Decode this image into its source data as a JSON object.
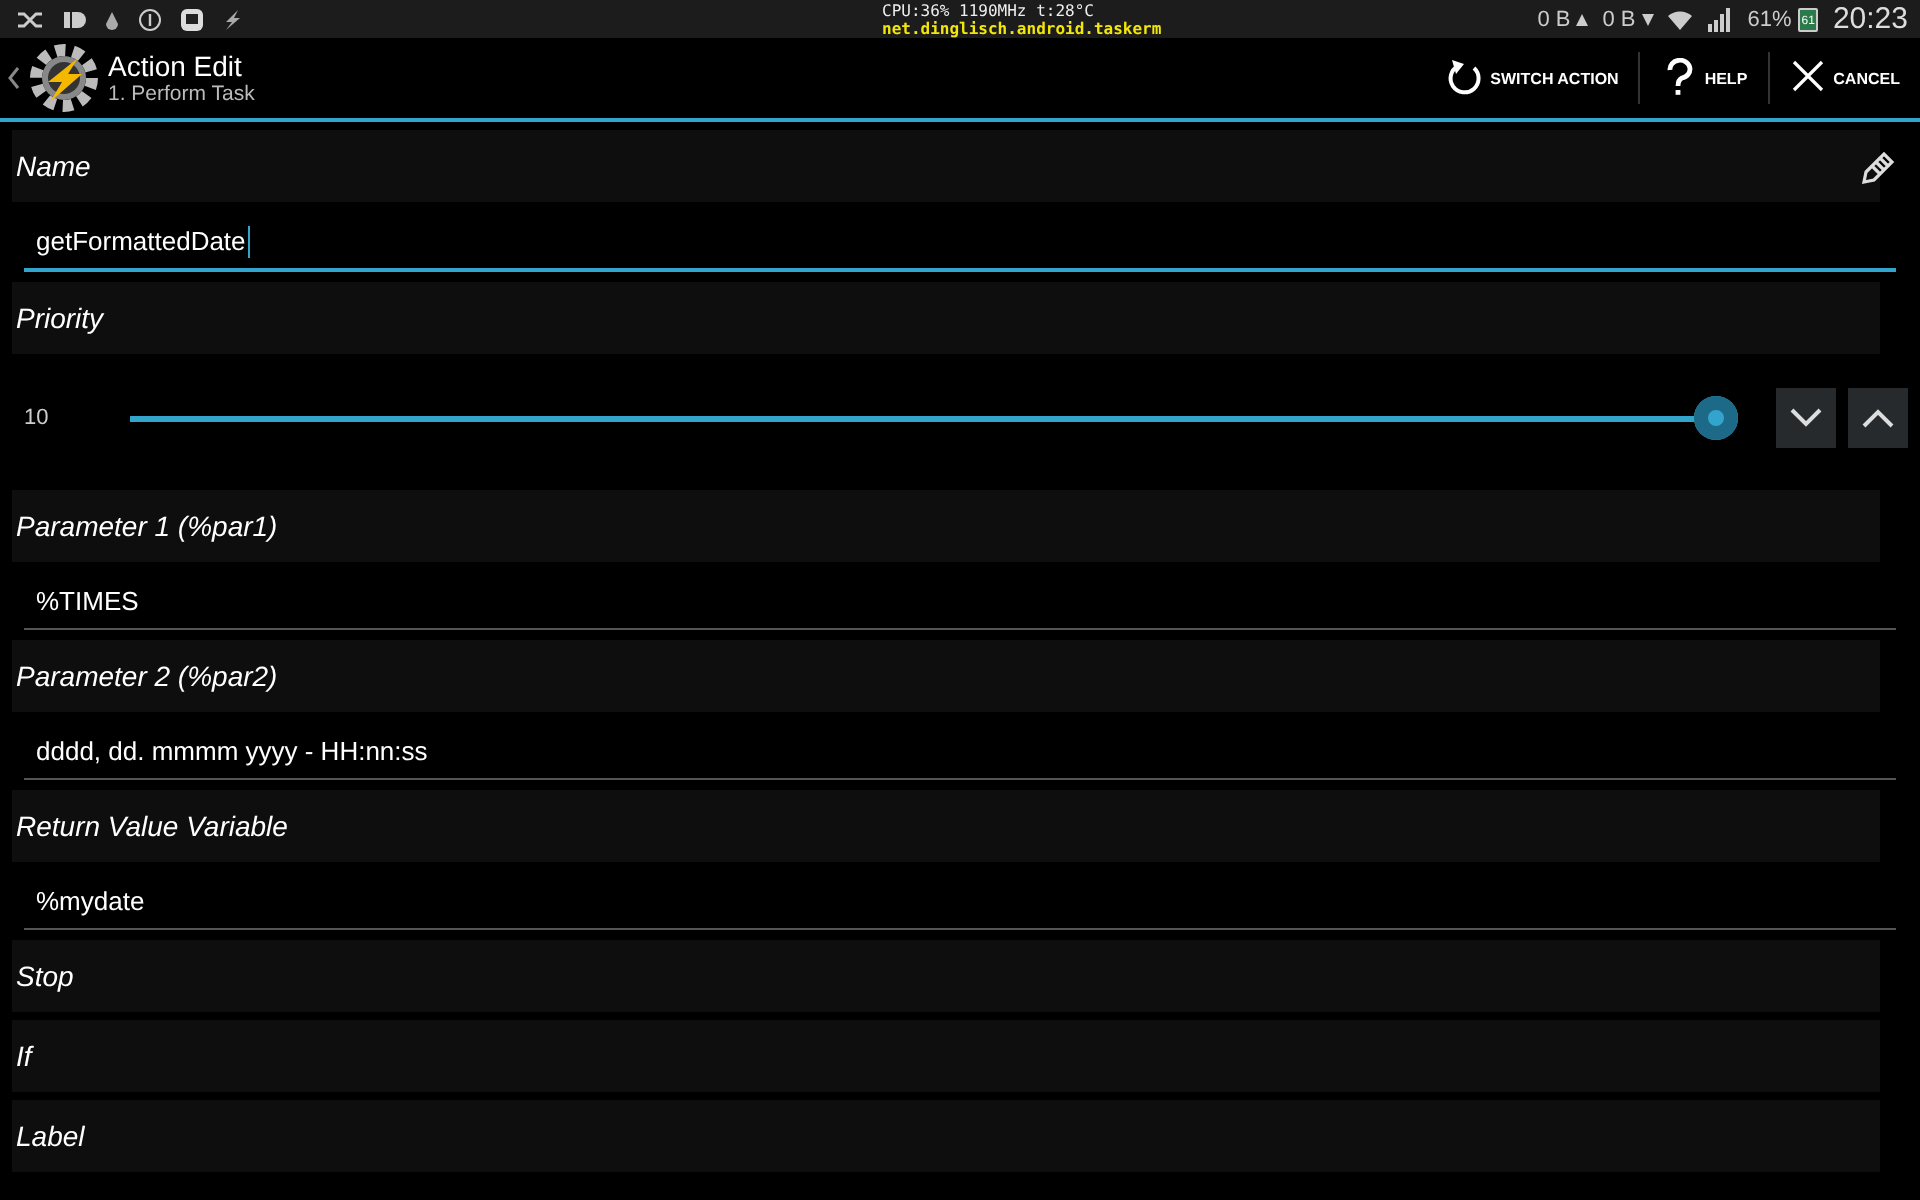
{
  "status_bar": {
    "cpu": "CPU:36% 1190MHz t:28°C",
    "package": "net.dinglisch.android.taskerm",
    "upload": "0 B",
    "download": "0 B",
    "battery": "61%",
    "battery_icon_text": "61",
    "time": "20:23"
  },
  "action_bar": {
    "title": "Action Edit",
    "subtitle": "1. Perform Task",
    "actions": [
      {
        "label": "SWITCH ACTION"
      },
      {
        "label": "HELP"
      },
      {
        "label": "CANCEL"
      }
    ]
  },
  "sections": [
    {
      "kind": "text",
      "label": "Name",
      "value": "getFormattedDate",
      "focused": true,
      "edit_icon": true
    },
    {
      "kind": "slider",
      "label": "Priority",
      "reading": "10",
      "level": 1
    },
    {
      "kind": "text",
      "label": "Parameter 1 (%par1)",
      "value": "%TIMES",
      "focused": false
    },
    {
      "kind": "text",
      "label": "Parameter 2 (%par2)",
      "value": "dddd,  dd. mmmm  yyyy - HH:nn:ss",
      "focused": false
    },
    {
      "kind": "text",
      "label": "Return Value Variable",
      "value": "%mydate",
      "focused": false
    },
    {
      "kind": "plain",
      "label": "Stop"
    },
    {
      "kind": "plain",
      "label": "If"
    },
    {
      "kind": "plain",
      "label": "Label"
    }
  ]
}
